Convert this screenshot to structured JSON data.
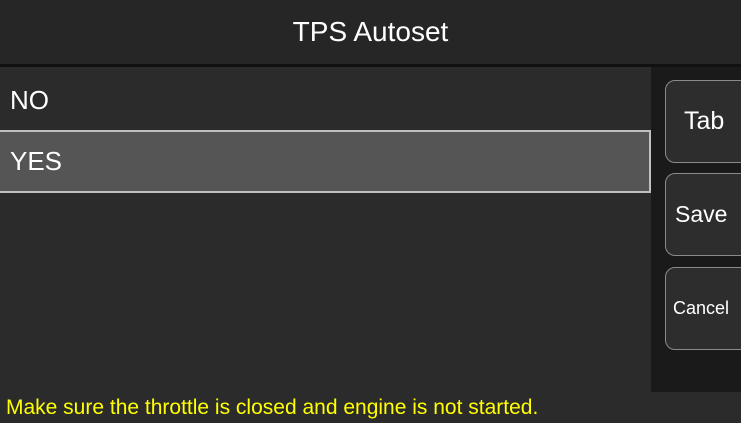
{
  "header": {
    "title": "TPS Autoset"
  },
  "options": {
    "items": [
      {
        "label": "NO",
        "selected": false
      },
      {
        "label": "YES",
        "selected": true
      }
    ]
  },
  "actions": {
    "tab_label": "Tab",
    "save_label": "Save",
    "cancel_label": "Cancel"
  },
  "status": {
    "message": "Make sure the throttle is closed and engine is not started.",
    "color": "#ffff00"
  },
  "colors": {
    "selected_bg": "#555555",
    "panel_bg": "#2b2b2b"
  }
}
